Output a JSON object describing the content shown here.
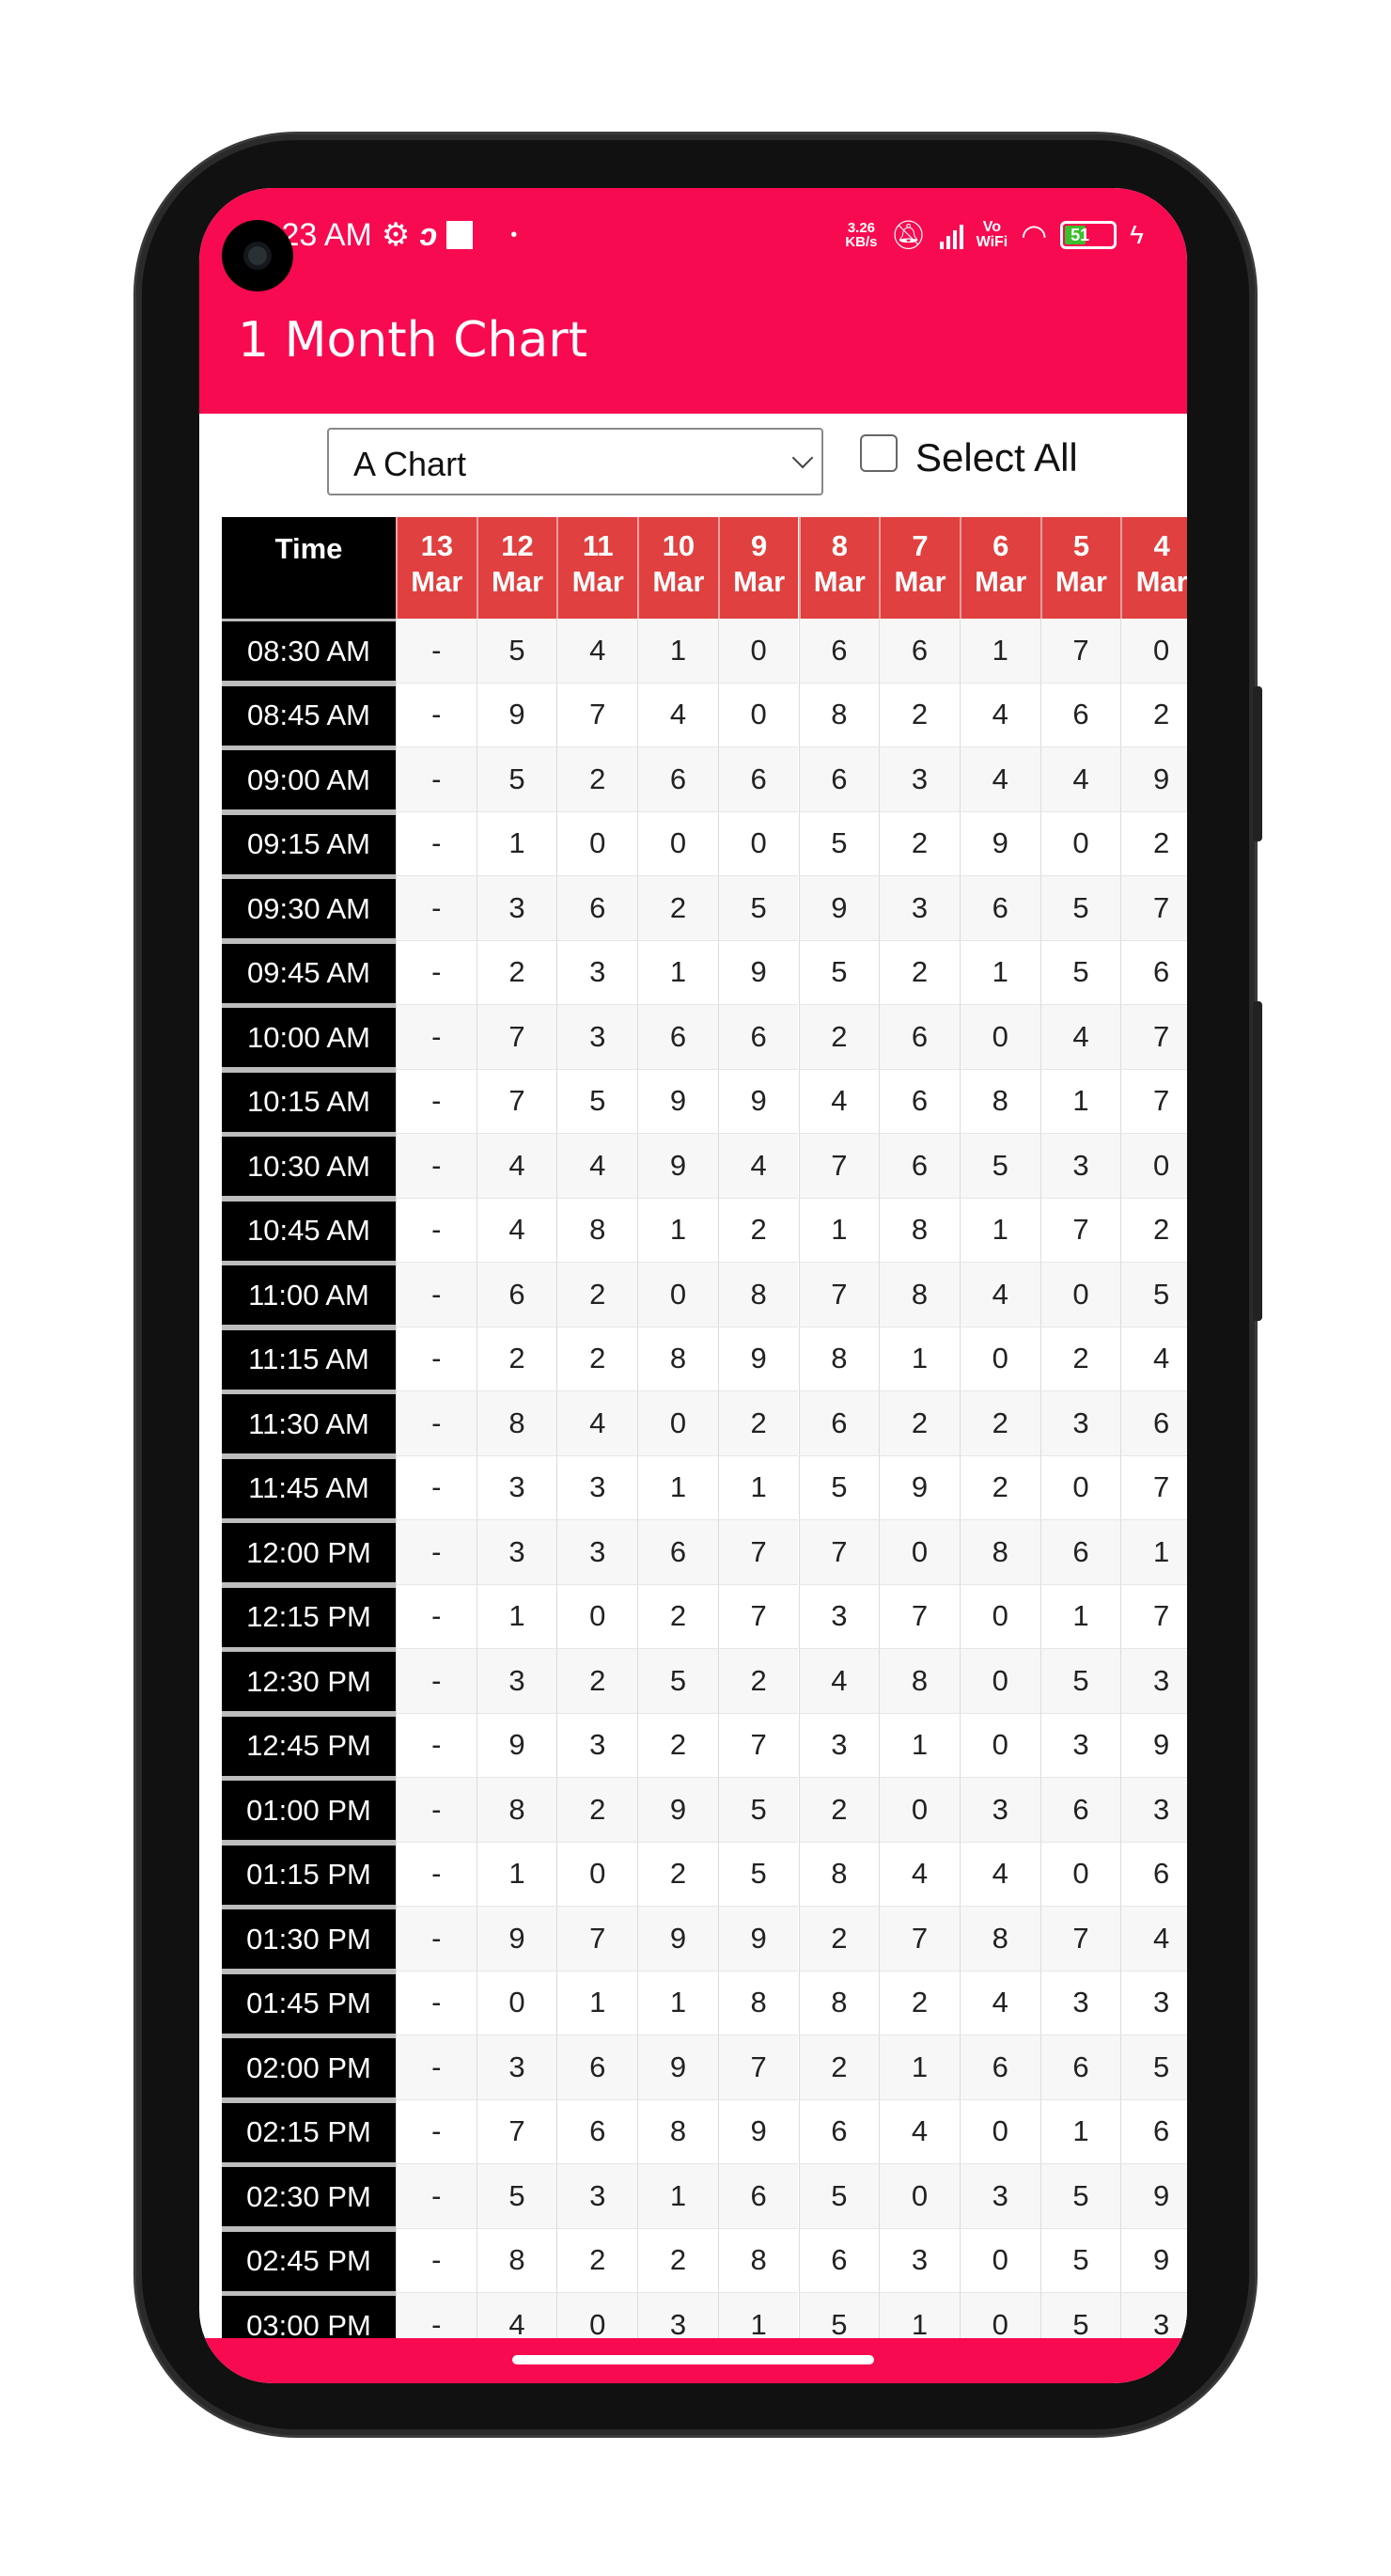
{
  "status_bar": {
    "time": ":23 AM",
    "network_speed_value": "3.26",
    "network_speed_unit": "KB/s",
    "vowifi_top": "Vo",
    "vowifi_bottom": "WiFi",
    "battery_level": "51",
    "icons": [
      "settings-icon",
      "airtel-icon",
      "square-notification-icon",
      "dot-icon",
      "mute-icon",
      "signal-icon",
      "wifi-icon",
      "battery-icon",
      "charging-icon"
    ]
  },
  "header": {
    "title": "1 Month Chart"
  },
  "controls": {
    "chart_select_value": "A Chart",
    "select_all_label": "Select All",
    "select_all_checked": false
  },
  "colors": {
    "brand": "#F80A50",
    "date_header": "#E0403F",
    "time_column": "#000000"
  },
  "table": {
    "time_header": "Time",
    "dates": [
      {
        "day": "13",
        "month": "Mar"
      },
      {
        "day": "12",
        "month": "Mar"
      },
      {
        "day": "11",
        "month": "Mar"
      },
      {
        "day": "10",
        "month": "Mar"
      },
      {
        "day": "9",
        "month": "Mar"
      },
      {
        "day": "8",
        "month": "Mar"
      },
      {
        "day": "7",
        "month": "Mar"
      },
      {
        "day": "6",
        "month": "Mar"
      },
      {
        "day": "5",
        "month": "Mar"
      },
      {
        "day": "4",
        "month": "Mar"
      }
    ],
    "rows": [
      {
        "time": "08:30 AM",
        "values": [
          "-",
          "5",
          "4",
          "1",
          "0",
          "6",
          "6",
          "1",
          "7",
          "0"
        ]
      },
      {
        "time": "08:45 AM",
        "values": [
          "-",
          "9",
          "7",
          "4",
          "0",
          "8",
          "2",
          "4",
          "6",
          "2"
        ]
      },
      {
        "time": "09:00 AM",
        "values": [
          "-",
          "5",
          "2",
          "6",
          "6",
          "6",
          "3",
          "4",
          "4",
          "9"
        ]
      },
      {
        "time": "09:15 AM",
        "values": [
          "-",
          "1",
          "0",
          "0",
          "0",
          "5",
          "2",
          "9",
          "0",
          "2"
        ]
      },
      {
        "time": "09:30 AM",
        "values": [
          "-",
          "3",
          "6",
          "2",
          "5",
          "9",
          "3",
          "6",
          "5",
          "7"
        ]
      },
      {
        "time": "09:45 AM",
        "values": [
          "-",
          "2",
          "3",
          "1",
          "9",
          "5",
          "2",
          "1",
          "5",
          "6"
        ]
      },
      {
        "time": "10:00 AM",
        "values": [
          "-",
          "7",
          "3",
          "6",
          "6",
          "2",
          "6",
          "0",
          "4",
          "7"
        ]
      },
      {
        "time": "10:15 AM",
        "values": [
          "-",
          "7",
          "5",
          "9",
          "9",
          "4",
          "6",
          "8",
          "1",
          "7"
        ]
      },
      {
        "time": "10:30 AM",
        "values": [
          "-",
          "4",
          "4",
          "9",
          "4",
          "7",
          "6",
          "5",
          "3",
          "0"
        ]
      },
      {
        "time": "10:45 AM",
        "values": [
          "-",
          "4",
          "8",
          "1",
          "2",
          "1",
          "8",
          "1",
          "7",
          "2"
        ]
      },
      {
        "time": "11:00 AM",
        "values": [
          "-",
          "6",
          "2",
          "0",
          "8",
          "7",
          "8",
          "4",
          "0",
          "5"
        ]
      },
      {
        "time": "11:15 AM",
        "values": [
          "-",
          "2",
          "2",
          "8",
          "9",
          "8",
          "1",
          "0",
          "2",
          "4"
        ]
      },
      {
        "time": "11:30 AM",
        "values": [
          "-",
          "8",
          "4",
          "0",
          "2",
          "6",
          "2",
          "2",
          "3",
          "6"
        ]
      },
      {
        "time": "11:45 AM",
        "values": [
          "-",
          "3",
          "3",
          "1",
          "1",
          "5",
          "9",
          "2",
          "0",
          "7"
        ]
      },
      {
        "time": "12:00 PM",
        "values": [
          "-",
          "3",
          "3",
          "6",
          "7",
          "7",
          "0",
          "8",
          "6",
          "1"
        ]
      },
      {
        "time": "12:15 PM",
        "values": [
          "-",
          "1",
          "0",
          "2",
          "7",
          "3",
          "7",
          "0",
          "1",
          "7"
        ]
      },
      {
        "time": "12:30 PM",
        "values": [
          "-",
          "3",
          "2",
          "5",
          "2",
          "4",
          "8",
          "0",
          "5",
          "3"
        ]
      },
      {
        "time": "12:45 PM",
        "values": [
          "-",
          "9",
          "3",
          "2",
          "7",
          "3",
          "1",
          "0",
          "3",
          "9"
        ]
      },
      {
        "time": "01:00 PM",
        "values": [
          "-",
          "8",
          "2",
          "9",
          "5",
          "2",
          "0",
          "3",
          "6",
          "3"
        ]
      },
      {
        "time": "01:15 PM",
        "values": [
          "-",
          "1",
          "0",
          "2",
          "5",
          "8",
          "4",
          "4",
          "0",
          "6"
        ]
      },
      {
        "time": "01:30 PM",
        "values": [
          "-",
          "9",
          "7",
          "9",
          "9",
          "2",
          "7",
          "8",
          "7",
          "4"
        ]
      },
      {
        "time": "01:45 PM",
        "values": [
          "-",
          "0",
          "1",
          "1",
          "8",
          "8",
          "2",
          "4",
          "3",
          "3"
        ]
      },
      {
        "time": "02:00 PM",
        "values": [
          "-",
          "3",
          "6",
          "9",
          "7",
          "2",
          "1",
          "6",
          "6",
          "5"
        ]
      },
      {
        "time": "02:15 PM",
        "values": [
          "-",
          "7",
          "6",
          "8",
          "9",
          "6",
          "4",
          "0",
          "1",
          "6"
        ]
      },
      {
        "time": "02:30 PM",
        "values": [
          "-",
          "5",
          "3",
          "1",
          "6",
          "5",
          "0",
          "3",
          "5",
          "9"
        ]
      },
      {
        "time": "02:45 PM",
        "values": [
          "-",
          "8",
          "2",
          "2",
          "8",
          "6",
          "3",
          "0",
          "5",
          "9"
        ]
      },
      {
        "time": "03:00 PM",
        "values": [
          "-",
          "4",
          "0",
          "3",
          "1",
          "5",
          "1",
          "0",
          "5",
          "3"
        ]
      }
    ]
  }
}
